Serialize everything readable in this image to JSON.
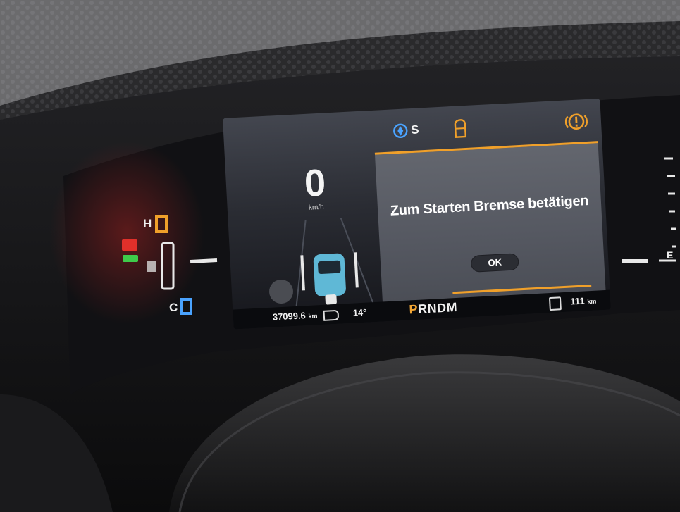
{
  "cluster": {
    "speed": {
      "value": "0",
      "unit": "km/h"
    },
    "top_icons": {
      "drive_mode_label": "S",
      "door_warning_color": "#f0a02a",
      "brake_warning_color": "#f0a02a",
      "drive_mode_color": "#4aa3ff"
    },
    "message": {
      "text": "Zum Starten Bremse betätigen",
      "ok_label": "OK",
      "accent_color": "#f0a02a"
    },
    "status_bar": {
      "odometer": "37099.6",
      "odometer_unit": "km",
      "temperature": "14°",
      "gear_active": "P",
      "gear_rest": "RNDM",
      "range": "111",
      "range_unit": "km"
    }
  },
  "left_gauge": {
    "top_label": "H",
    "bottom_label": "C",
    "battery_warning_color": "#e0302a",
    "lights_indicator_color": "#3ecb4a",
    "top_marker_color": "#f0a02a",
    "bottom_marker_color": "#4aa3ff"
  },
  "right_gauge": {
    "label": "E"
  }
}
